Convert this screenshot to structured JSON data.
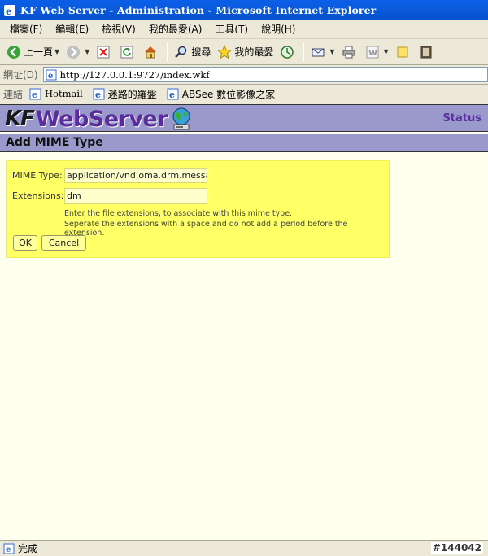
{
  "window": {
    "title": "KF Web Server - Administration - Microsoft Internet Explorer"
  },
  "menu": [
    "檔案(F)",
    "編輯(E)",
    "檢視(V)",
    "我的最愛(A)",
    "工具(T)",
    "說明(H)"
  ],
  "toolbar": {
    "back_label": "上一頁",
    "search_label": "搜尋",
    "favorites_label": "我的最愛"
  },
  "address": {
    "label": "網址(D)",
    "url": "http://127.0.0.1:9727/index.wkf"
  },
  "links": {
    "label": "連結",
    "items": [
      "Hotmail",
      "迷路的羅盤",
      "ABSee 數位影像之家"
    ]
  },
  "page": {
    "logo_kf": "KF",
    "logo_ws": "WebServer",
    "status_link": "Status",
    "section_title": "Add MIME Type",
    "form": {
      "mime_label": "MIME Type:",
      "mime_value": "application/vnd.oma.drm.messa",
      "ext_label": "Extensions:",
      "ext_value": "dm",
      "hint1": "Enter the file extensions, to associate with this mime type.",
      "hint2": "Seperate the extensions with a space and do not add a period before the extension.",
      "ok_label": "OK",
      "cancel_label": "Cancel"
    }
  },
  "statusbar": {
    "text": "完成",
    "right_id": "#144042"
  }
}
